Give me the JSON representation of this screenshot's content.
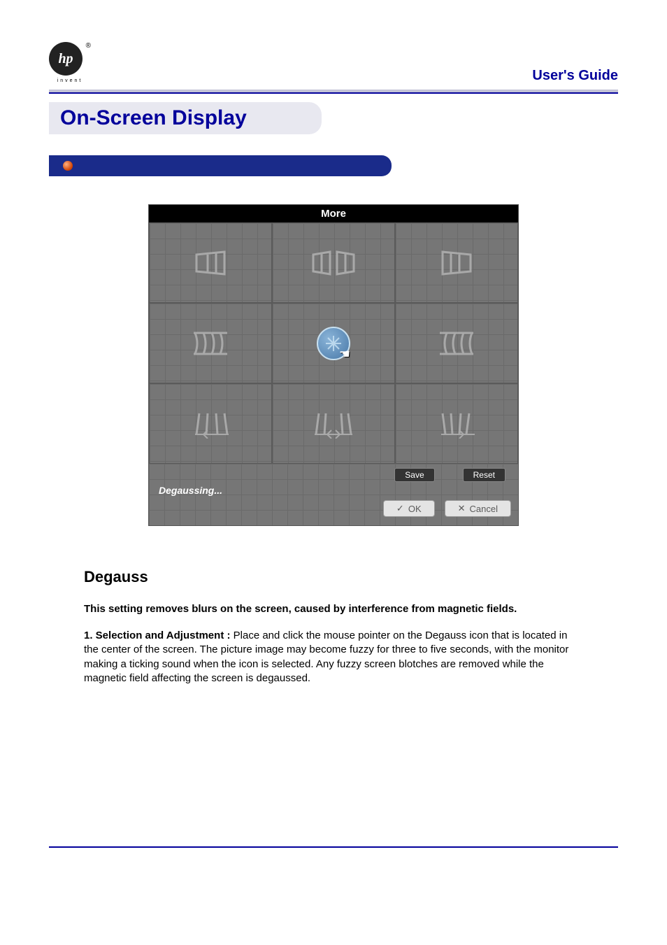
{
  "header": {
    "logo_text": "hp",
    "logo_subtext": "invent",
    "logo_reg": "®",
    "doc_title": "User's Guide"
  },
  "page_title": "On-Screen Display",
  "osd": {
    "title": "More",
    "status": "Degaussing...",
    "save_btn": "Save",
    "reset_btn": "Reset",
    "ok_btn": "OK",
    "cancel_btn": "Cancel",
    "icons": {
      "tl": "parallelogram-left",
      "tc": "parallelogram-balance",
      "tr": "parallelogram-right",
      "ml": "pincushion-left",
      "mc": "degauss",
      "mr": "pincushion-right",
      "bl": "trapezoid-left",
      "bc": "trapezoid-balance",
      "br": "trapezoid-right"
    }
  },
  "content": {
    "heading": "Degauss",
    "intro": "This setting removes blurs on the screen, caused by interference from magnetic fields.",
    "step_label": "1. Selection and Adjustment :",
    "step_text": " Place and click the mouse pointer on the Degauss icon that is located in the center of the screen. The picture image may become fuzzy for three to five seconds, with the monitor making a ticking sound when the icon is selected. Any fuzzy screen blotches are removed while the magnetic field affecting the screen is degaussed."
  }
}
